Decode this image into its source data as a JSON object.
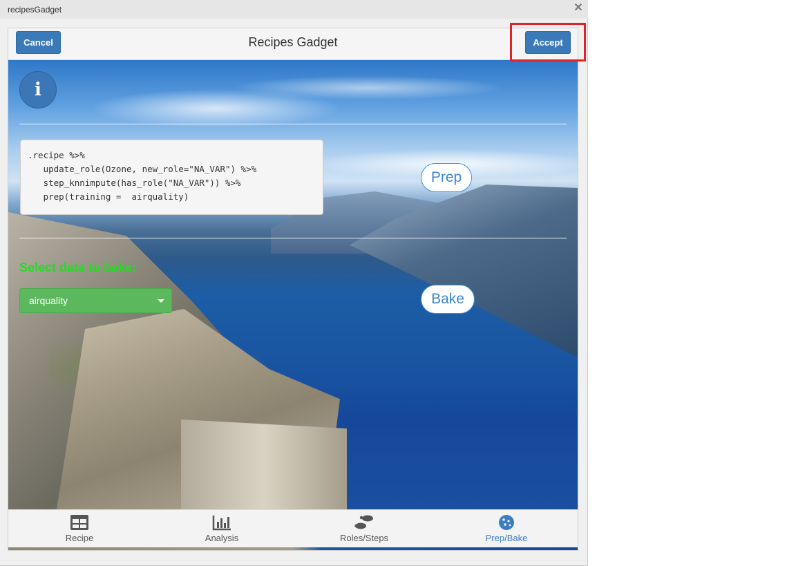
{
  "window": {
    "title": "recipesGadget",
    "close_glyph": "✕"
  },
  "header": {
    "title": "Recipes Gadget",
    "cancel_label": "Cancel",
    "accept_label": "Accept"
  },
  "info": {
    "icon": "info-icon",
    "glyph": "i"
  },
  "code": {
    "lines": [
      ".recipe %>%",
      "   update_role(Ozone, new_role=\"NA_VAR\") %>%",
      "   step_knnimpute(has_role(\"NA_VAR\")) %>%",
      "   prep(training =  airquality)"
    ]
  },
  "buttons": {
    "prep_label": "Prep",
    "bake_label": "Bake"
  },
  "bake": {
    "select_label": "Select data to bake:",
    "selected_value": "airquality"
  },
  "tabs": [
    {
      "label": "Recipe",
      "icon": "table-icon"
    },
    {
      "label": "Analysis",
      "icon": "bar-chart-icon"
    },
    {
      "label": "Roles/Steps",
      "icon": "footsteps-icon"
    },
    {
      "label": "Prep/Bake",
      "icon": "cookie-icon",
      "active": true
    }
  ],
  "colors": {
    "primary": "#3a7ab8",
    "success": "#5cb85c",
    "highlight": "#e0222b",
    "label_green": "#22dd22",
    "active_tab": "#3c7dc4"
  }
}
